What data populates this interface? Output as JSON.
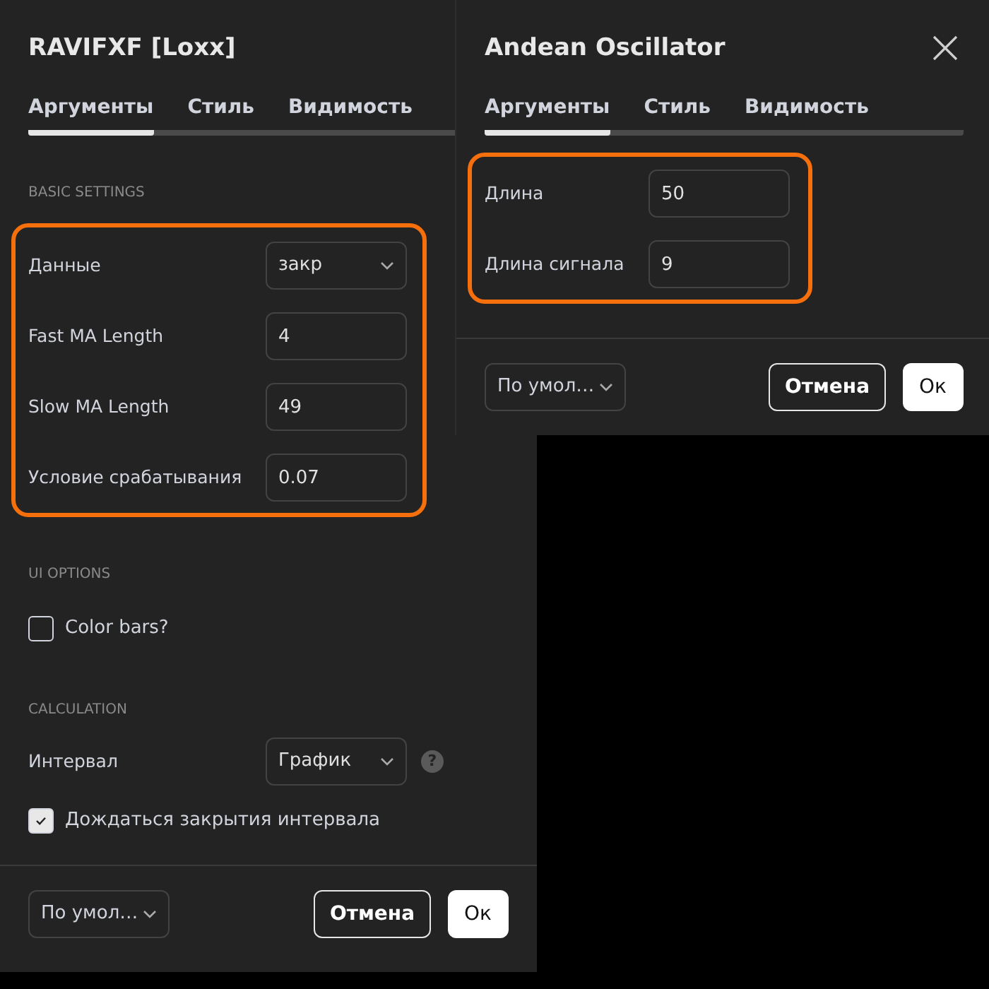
{
  "panels": [
    {
      "title": "RAVIFXF [Loxx]",
      "tabs": [
        {
          "label": "Аргументы",
          "selected": true
        },
        {
          "label": "Стиль",
          "selected": false
        },
        {
          "label": "Видимость",
          "selected": false
        }
      ],
      "sections": [
        {
          "heading": "BASIC SETTINGS",
          "highlighted": true,
          "rows": [
            {
              "kind": "select",
              "label": "Данные",
              "value": "закр"
            },
            {
              "kind": "input",
              "label": "Fast MA Length",
              "value": "4"
            },
            {
              "kind": "input",
              "label": "Slow MA Length",
              "value": "49"
            },
            {
              "kind": "input",
              "label": "Условие срабатывания",
              "value": "0.07"
            }
          ]
        },
        {
          "heading": "UI OPTIONS",
          "rows": [
            {
              "kind": "checkbox",
              "label": "Color bars?",
              "checked": false
            }
          ]
        },
        {
          "heading": "CALCULATION",
          "rows": [
            {
              "kind": "select",
              "label": "Интервал",
              "value": "График",
              "help": "?"
            },
            {
              "kind": "checkbox",
              "label": "Дождаться закрытия интервала",
              "checked": true
            }
          ]
        }
      ],
      "footer": {
        "preset": "По умол…",
        "cancel": "Отмена",
        "ok": "Ок"
      }
    },
    {
      "title": "Andean Oscillator",
      "close": true,
      "tabs": [
        {
          "label": "Аргументы",
          "selected": true
        },
        {
          "label": "Стиль",
          "selected": false
        },
        {
          "label": "Видимость",
          "selected": false
        }
      ],
      "sections": [
        {
          "highlighted": true,
          "rows": [
            {
              "kind": "input",
              "label": "Длина",
              "value": "50"
            },
            {
              "kind": "input",
              "label": "Длина сигнала",
              "value": "9"
            }
          ]
        }
      ],
      "footer": {
        "preset": "По умол…",
        "cancel": "Отмена",
        "ok": "Ок"
      }
    }
  ]
}
